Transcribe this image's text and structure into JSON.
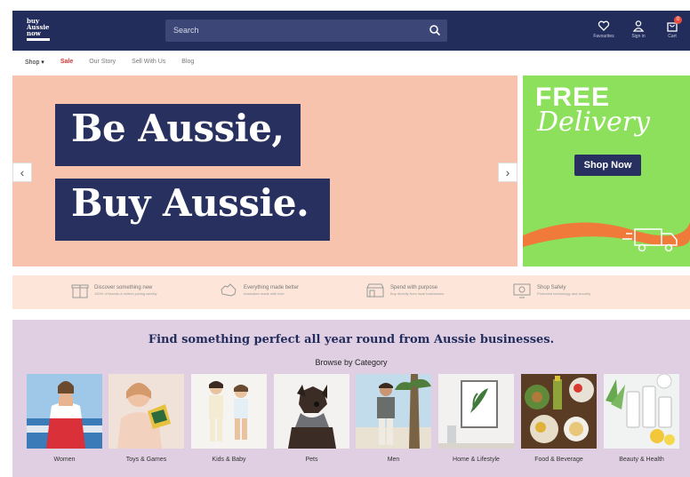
{
  "header": {
    "logo_lines": [
      "buy",
      "Aussie",
      "now"
    ],
    "search_placeholder": "Search",
    "favourites_label": "Favourites",
    "signin_label": "Sign in",
    "cart_label": "Cart",
    "cart_count": "0"
  },
  "nav": {
    "items": [
      {
        "label": "Shop ▾"
      },
      {
        "label": "Sale"
      },
      {
        "label": "Our Story"
      },
      {
        "label": "Sell With Us"
      },
      {
        "label": "Blog"
      }
    ]
  },
  "hero": {
    "line1": "Be Aussie,",
    "line2": "Buy Aussie.",
    "prev": "‹",
    "next": "›"
  },
  "promo": {
    "free": "FREE",
    "delivery": "Delivery",
    "cta": "Shop Now"
  },
  "benefits": [
    {
      "title": "Discover something new",
      "sub": "100% of brands & sellers joining weekly"
    },
    {
      "title": "Everything made better",
      "sub": "Australian made with love"
    },
    {
      "title": "Spend with purpose",
      "sub": "Buy directly from local businesses"
    },
    {
      "title": "Shop Safely",
      "sub": "Protected technology and security"
    }
  ],
  "categories": {
    "title": "Find something perfect all year round from Aussie businesses.",
    "subtitle": "Browse by Category",
    "items": [
      {
        "label": "Women"
      },
      {
        "label": "Toys & Games"
      },
      {
        "label": "Kids & Baby"
      },
      {
        "label": "Pets"
      },
      {
        "label": "Men"
      },
      {
        "label": "Home & Lifestyle"
      },
      {
        "label": "Food & Beverage"
      },
      {
        "label": "Beauty & Health"
      }
    ]
  },
  "colors": {
    "navy": "#232d5c",
    "hero_peach": "#f7c3ad",
    "promo_green": "#8de05b",
    "benefit_strip": "#fde6d9",
    "category_bg": "#e0cfe3",
    "sale_red": "#d63333"
  }
}
